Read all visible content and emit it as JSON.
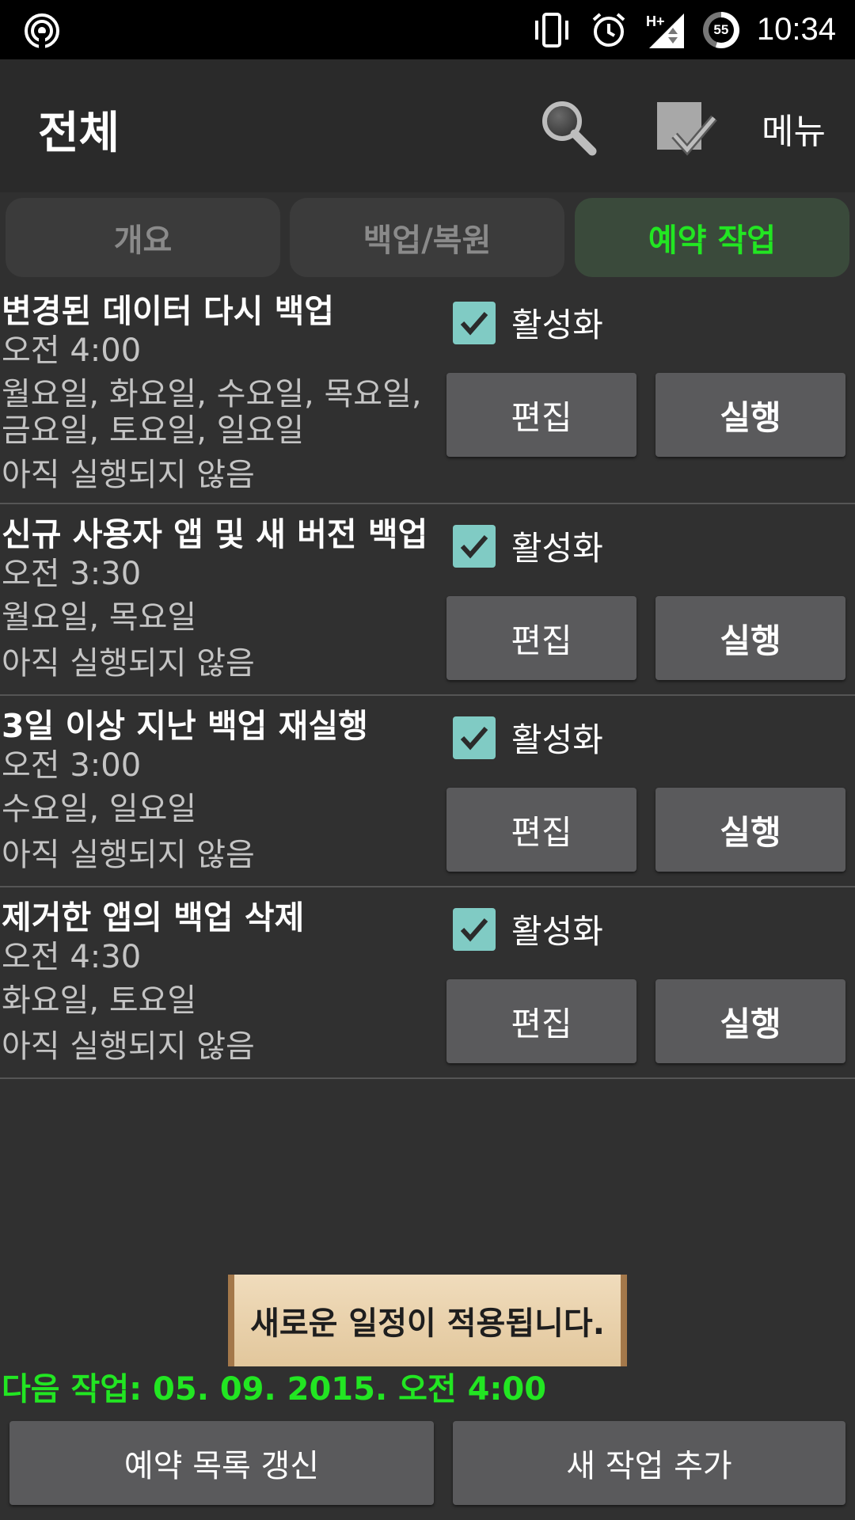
{
  "status_bar": {
    "time": "10:34",
    "battery_level": "55",
    "network_label": "H+",
    "icons": [
      "wifi-hotspot-icon",
      "vibrate-icon",
      "alarm-icon",
      "signal-icon",
      "battery-icon"
    ]
  },
  "app_bar": {
    "title": "전체",
    "menu_label": "메뉴",
    "icons": [
      "search-icon",
      "check-all-icon"
    ]
  },
  "tabs": [
    {
      "label": "개요",
      "active": false
    },
    {
      "label": "백업/복원",
      "active": false
    },
    {
      "label": "예약 작업",
      "active": true
    }
  ],
  "tasks": [
    {
      "title": "변경된 데이터 다시 백업",
      "time": "오전 4:00",
      "days_line1": "월요일, 화요일, 수요일, 목요일,",
      "days_line2": "금요일, 토요일, 일요일",
      "status": "아직 실행되지 않음",
      "enabled_label": "활성화",
      "enabled": true,
      "edit_label": "편집",
      "run_label": "실행"
    },
    {
      "title": "신규 사용자 앱 및 새 버전 백업",
      "time": "오전 3:30",
      "days_line1": "월요일, 목요일",
      "status": "아직 실행되지 않음",
      "enabled_label": "활성화",
      "enabled": true,
      "edit_label": "편집",
      "run_label": "실행"
    },
    {
      "title": "3일 이상 지난 백업 재실행",
      "time": "오전 3:00",
      "days_line1": "수요일, 일요일",
      "status": "아직 실행되지 않음",
      "enabled_label": "활성화",
      "enabled": true,
      "edit_label": "편집",
      "run_label": "실행"
    },
    {
      "title": "제거한 앱의 백업 삭제",
      "time": "오전 4:30",
      "days_line1": "화요일, 토요일",
      "status": "아직 실행되지 않음",
      "enabled_label": "활성화",
      "enabled": true,
      "edit_label": "편집",
      "run_label": "실행"
    }
  ],
  "toast": "새로운 일정이 적용됩니다.",
  "next_task": "다음 작업: 05. 09. 2015. 오전 4:00",
  "bottom_buttons": {
    "refresh_label": "예약 목록 갱신",
    "add_label": "새 작업 추가"
  },
  "colors": {
    "accent_green": "#22e622",
    "checkbox_teal": "#80cbc4",
    "button_gray": "#5a5a5c",
    "background": "#303030"
  }
}
